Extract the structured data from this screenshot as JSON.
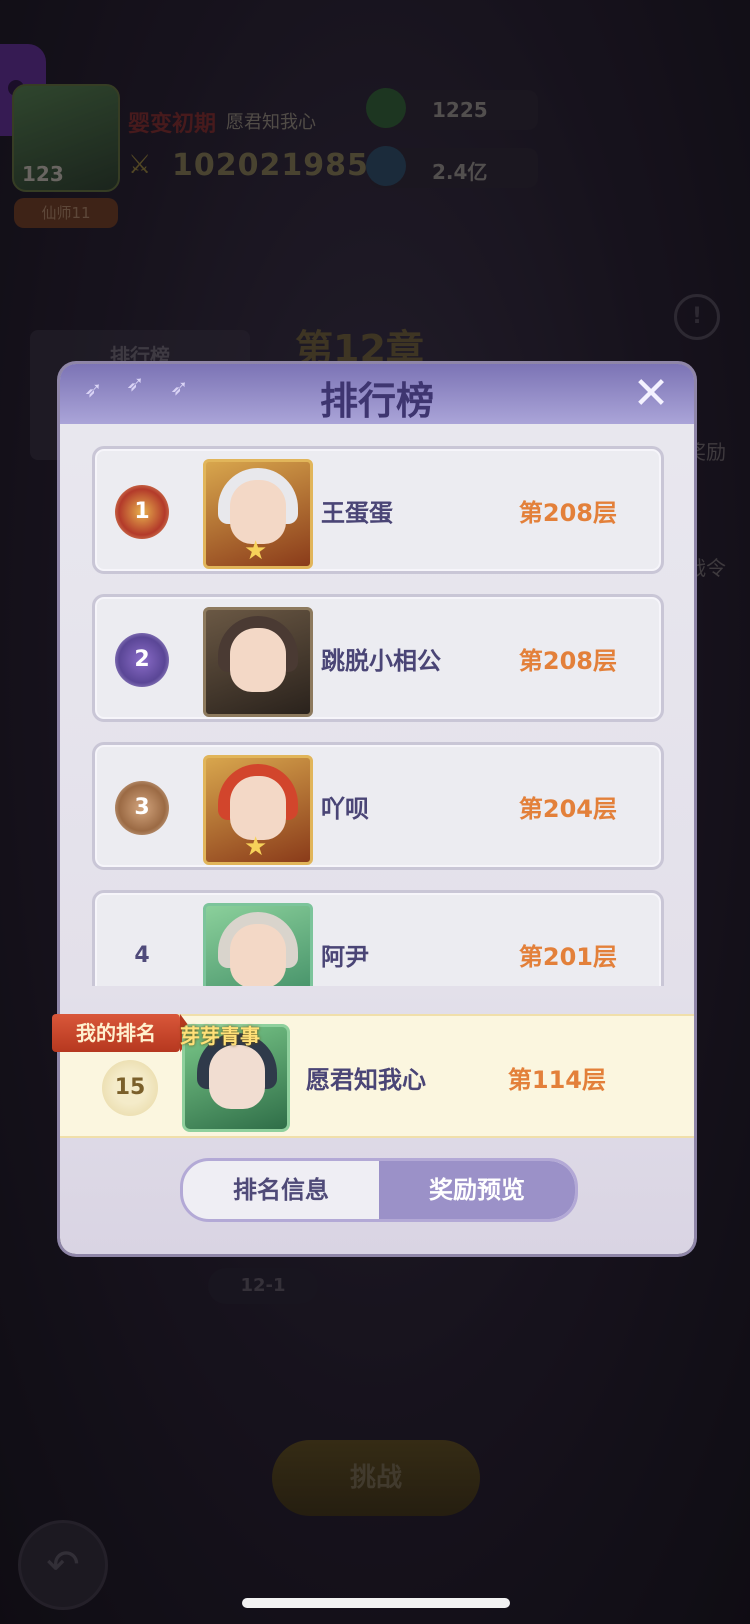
{
  "hud": {
    "level": "123",
    "realm": "婴变初期",
    "player_name": "愿君知我心",
    "power": "102021985",
    "title_badge": "仙师11",
    "resource1": "1225",
    "resource2": "2.4亿"
  },
  "background": {
    "chapter": "第12章",
    "mini_rank_title": "排行榜",
    "stage": "12-1",
    "challenge": "挑战",
    "side_labels": [
      "奖励",
      "战令"
    ]
  },
  "modal": {
    "title": "排行榜",
    "entries": [
      {
        "rank": "1",
        "name": "王蛋蛋",
        "floor": "第208层"
      },
      {
        "rank": "2",
        "name": "跳脱小相公",
        "floor": "第208层"
      },
      {
        "rank": "3",
        "name": "吖呗",
        "floor": "第204层"
      },
      {
        "rank": "4",
        "name": "阿尹",
        "floor": "第201层"
      }
    ],
    "my_rank": {
      "ribbon": "我的排名",
      "tag": "芽芽青事",
      "rank": "15",
      "name": "愿君知我心",
      "floor": "第114层"
    },
    "tabs": {
      "info": "排名信息",
      "reward": "奖励预览"
    }
  },
  "colors": {
    "accent_orange": "#e3803a",
    "header_purple": "#7c74b5",
    "tab_active": "#9b91c8"
  }
}
